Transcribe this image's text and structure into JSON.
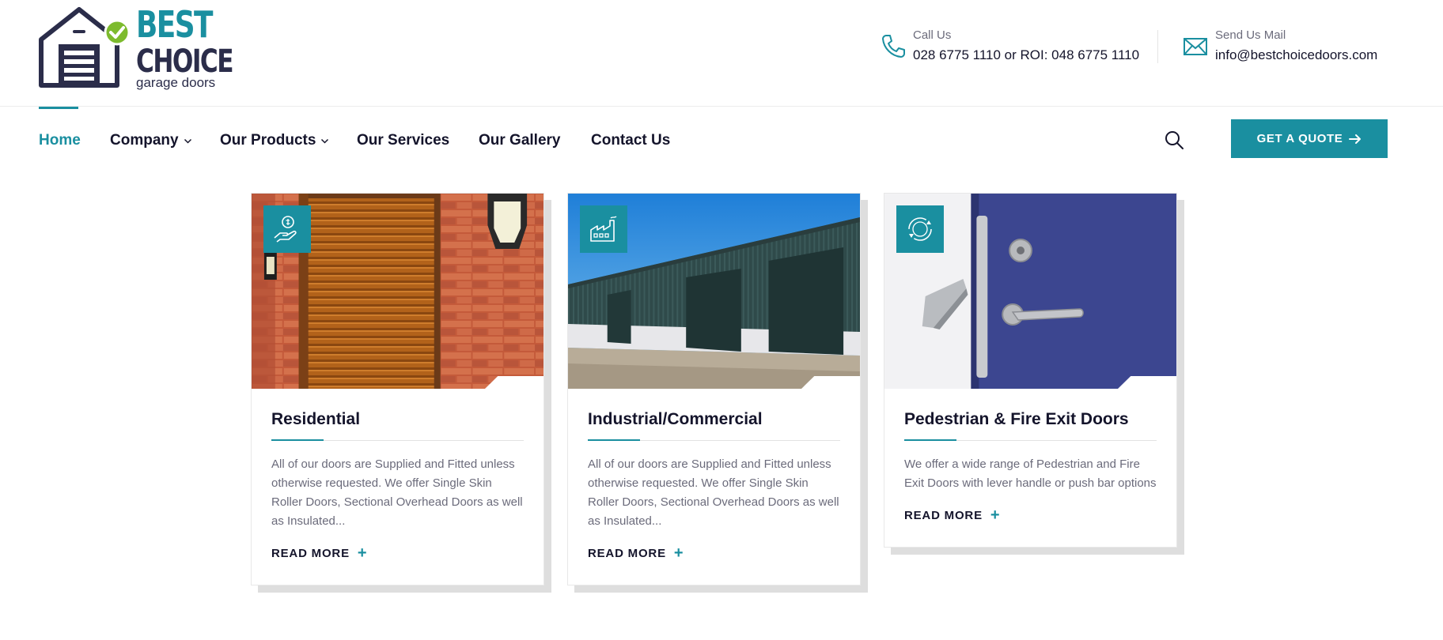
{
  "brand": {
    "line1": "BEST",
    "line2": "CHOICE",
    "line3": "garage doors"
  },
  "contact": {
    "phone_label": "Call Us",
    "phone_value": "028 6775 1110 or ROI: 048 6775 1110",
    "mail_label": "Send Us Mail",
    "mail_value": "info@bestchoicedoors.com"
  },
  "nav": {
    "home": "Home",
    "company": "Company",
    "products": "Our Products",
    "services": "Our Services",
    "gallery": "Our Gallery",
    "contact": "Contact Us",
    "quote": "GET A QUOTE"
  },
  "cards": [
    {
      "title": "Residential",
      "text": "All of our doors are Supplied and Fitted unless otherwise requested. We offer Single Skin Roller Doors, Sectional Overhead Doors as well as Insulated...",
      "more": "READ MORE",
      "icon": "hand-money-icon"
    },
    {
      "title": "Industrial/Commercial",
      "text": "All of our doors are Supplied and Fitted unless otherwise requested. We offer Single Skin Roller Doors, Sectional Overhead Doors as well as Insulated...",
      "more": "READ MORE",
      "icon": "factory-icon"
    },
    {
      "title": "Pedestrian & Fire Exit Doors",
      "text": "We offer a wide range of Pedestrian and Fire Exit Doors with lever handle or push bar options",
      "more": "READ MORE",
      "icon": "cycle-arrows-icon"
    }
  ],
  "colors": {
    "accent": "#1a8fa0",
    "dark": "#14142b",
    "muted": "#6b6b7b",
    "logo_check": "#7dbb2e"
  }
}
